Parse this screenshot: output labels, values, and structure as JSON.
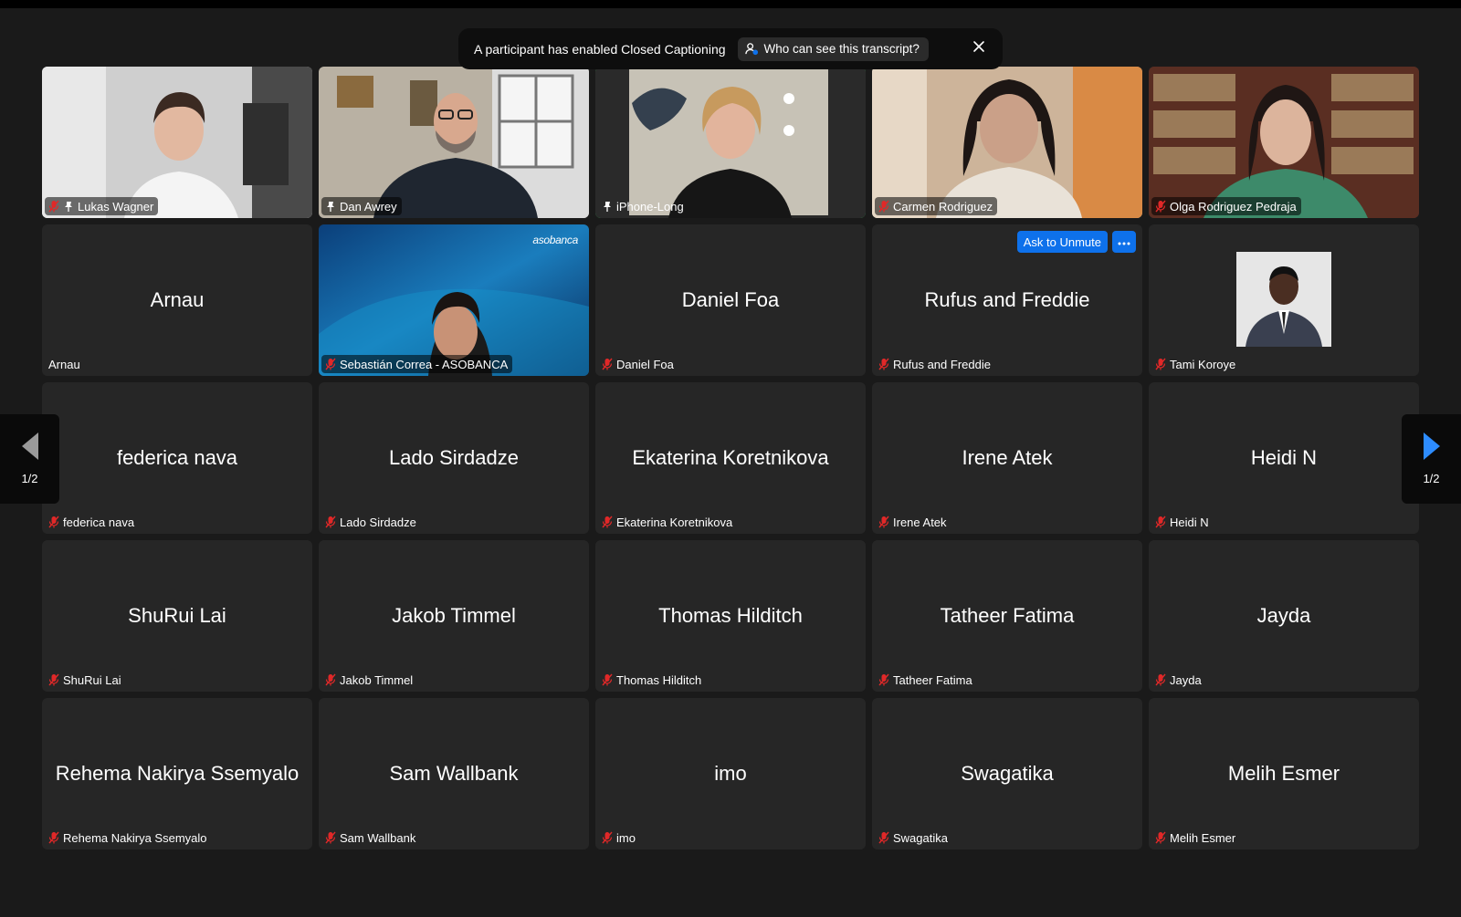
{
  "banner": {
    "message": "A participant has enabled Closed Captioning",
    "who_button": "Who can see this transcript?"
  },
  "nav": {
    "page_left": "1/2",
    "page_right": "1/2"
  },
  "tile_actions": {
    "ask_unmute": "Ask to Unmute"
  },
  "colors": {
    "accent": "#0e71eb",
    "active_speaker": "#23c552",
    "muted": "#e02828"
  },
  "participants": [
    {
      "label": "Lukas Wagner",
      "display": ""
    },
    {
      "label": "Dan Awrey",
      "display": ""
    },
    {
      "label": "iPhone-Long",
      "display": ""
    },
    {
      "label": "Carmen Rodriguez",
      "display": ""
    },
    {
      "label": "Olga Rodriguez Pedraja",
      "display": ""
    },
    {
      "label": "Arnau",
      "display": "Arnau"
    },
    {
      "label": "Sebastián Correa - ASOBANCA",
      "display": "",
      "logo_text": "asobanca"
    },
    {
      "label": "Daniel Foa",
      "display": "Daniel Foa"
    },
    {
      "label": "Rufus and Freddie",
      "display": "Rufus and Freddie"
    },
    {
      "label": "Tami Koroye",
      "display": ""
    },
    {
      "label": "federica nava",
      "display": "federica nava"
    },
    {
      "label": "Lado Sirdadze",
      "display": "Lado Sirdadze"
    },
    {
      "label": "Ekaterina Koretnikova",
      "display": "Ekaterina Koretnikova"
    },
    {
      "label": "Irene Atek",
      "display": "Irene Atek"
    },
    {
      "label": "Heidi N",
      "display": "Heidi N"
    },
    {
      "label": "ShuRui Lai",
      "display": "ShuRui Lai"
    },
    {
      "label": "Jakob Timmel",
      "display": "Jakob Timmel"
    },
    {
      "label": "Thomas Hilditch",
      "display": "Thomas Hilditch"
    },
    {
      "label": "Tatheer Fatima",
      "display": "Tatheer Fatima"
    },
    {
      "label": "Jayda",
      "display": "Jayda"
    },
    {
      "label": "Rehema Nakirya Ssemyalo",
      "display": "Rehema Nakirya Ssemyalo"
    },
    {
      "label": "Sam Wallbank",
      "display": "Sam Wallbank"
    },
    {
      "label": "imo",
      "display": "imo"
    },
    {
      "label": "Swagatika",
      "display": "Swagatika"
    },
    {
      "label": "Melih Esmer",
      "display": "Melih Esmer"
    }
  ]
}
